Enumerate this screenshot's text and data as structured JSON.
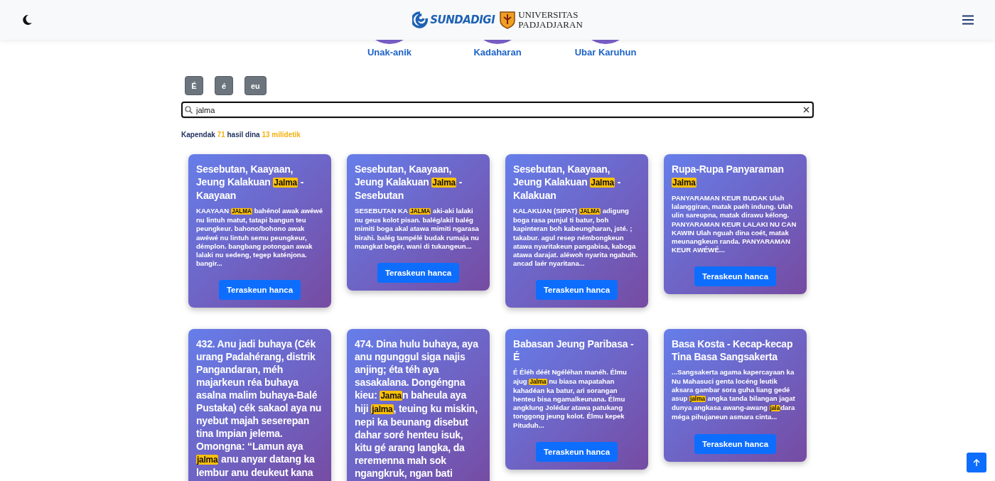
{
  "header": {
    "brand": "SUNDADIGI",
    "university_line_1": "UNIVERSITAS",
    "university_line_2": "PADJADJARAN"
  },
  "categories": [
    {
      "label": "Unak-anik"
    },
    {
      "label": "Kadaharan"
    },
    {
      "label": "Ubar Karuhun"
    }
  ],
  "letter_buttons": [
    "É",
    "é",
    "eu"
  ],
  "search": {
    "value": "jalma"
  },
  "summary": {
    "prefix": "Kapendak",
    "count": "71",
    "middle": "hasil dina",
    "time": "13 milidetik"
  },
  "cards": [
    {
      "title": [
        {
          "text": "Sesebutan, Kaayaan, Jeung Kalakuan ",
          "highlight": false
        },
        {
          "text": "Jalma",
          "highlight": true
        },
        {
          "text": " - Kaayaan",
          "highlight": false
        }
      ],
      "snippet": [
        {
          "text": "KAAYAAN ",
          "highlight": false
        },
        {
          "text": "JALMA",
          "highlight": true
        },
        {
          "text": " bahénol awak awéwé nu lintuh matut, tatapi bangun teu peungkeur. bahono/bohono awak awéwé nu lintuh semu peungkeur, démplon. bangbang potongan awak lalaki nu sedeng, tegep katénjona. bangir...",
          "highlight": false
        }
      ],
      "button": "Teraskeun hanca"
    },
    {
      "title": [
        {
          "text": "Sesebutan, Kaayaan, Jeung Kalakuan ",
          "highlight": false
        },
        {
          "text": "Jalma",
          "highlight": true
        },
        {
          "text": " - Sesebutan",
          "highlight": false
        }
      ],
      "snippet": [
        {
          "text": "SESEBUTAN KA ",
          "highlight": false
        },
        {
          "text": "JALMA",
          "highlight": true
        },
        {
          "text": " aki-aki lalaki nu geus kolot pisan. balég/akil balég mimiti boga akal atawa mimiti ngarasa birahi. balég tampélé budak rumaja nu mangkat begér, wani di tukangeun...",
          "highlight": false
        }
      ],
      "button": "Teraskeun hanca"
    },
    {
      "title": [
        {
          "text": "Sesebutan, Kaayaan, Jeung Kalakuan ",
          "highlight": false
        },
        {
          "text": "Jalma",
          "highlight": true
        },
        {
          "text": " - Kalakuan",
          "highlight": false
        }
      ],
      "snippet": [
        {
          "text": "KALAKUAN (SIPAT) ",
          "highlight": false
        },
        {
          "text": "JALMA",
          "highlight": true
        },
        {
          "text": " adigung boga rasa punjul ti batur, boh kapinteran boh kabeungharan, jsté. ; takabur. agul resep némbongkeun atawa nyaritakeun pangabisa, kaboga atawa darajat. aléwoh nyarita ngabuih. ancad laér nyaritana...",
          "highlight": false
        }
      ],
      "button": "Teraskeun hanca"
    },
    {
      "title": [
        {
          "text": "Rupa-Rupa Panyaraman ",
          "highlight": false
        },
        {
          "text": "Jalma",
          "highlight": true
        }
      ],
      "snippet": [
        {
          "text": "PANYARAMAN KEUR BUDAK Ulah lalanggiran, matak paéh indung. Ulah ulin sareupna, matak dirawu kélong. PANYARAMAN KEUR LALAKI NU CAN KAWIN Ulah nguah dina coét, matak meunangkeun randa. PANYARAMAN KEUR AWÉWÉ...",
          "highlight": false
        }
      ],
      "button": "Teraskeun hanca"
    },
    {
      "title": [
        {
          "text": "432. Anu jadi buhaya (Cék urang Padahérang, distrik Pangandaran, méh majarkeun réa buhaya asalna malim buhaya-Balé Pustaka) cék sakaol aya nu nyebut majah seserepan tina Impian jelema. Omongna: “Lamun aya ",
          "highlight": false
        },
        {
          "text": "jalma",
          "highlight": true
        },
        {
          "text": " anu anyar datang ka lembur anu deukeut kana",
          "highlight": false
        }
      ]
    },
    {
      "title": [
        {
          "text": "474. Dina hulu buhaya, aya anu ngunggul siga najis anjing; éta téh aya sasakalana. Dongéngna kieu: ",
          "highlight": false
        },
        {
          "text": "Jama",
          "highlight": true
        },
        {
          "text": "n baheula aya hiji ",
          "highlight": false
        },
        {
          "text": "jalma",
          "highlight": true
        },
        {
          "text": ", teuing ku miskin, nepi ka beunang disebut dahar soré henteu isuk, kitu gé arang langka, da reremenna mah sok ngangkruk, ngan bati",
          "highlight": false
        }
      ]
    },
    {
      "title": [
        {
          "text": "Babasan Jeung Paribasa - É",
          "highlight": false
        }
      ],
      "snippet": [
        {
          "text": "É Éléh déét Ngéléhan manéh. Élmu ajug ",
          "highlight": false
        },
        {
          "text": "Jalma",
          "highlight": true
        },
        {
          "text": " nu biasa mapatahan kahadéan ka batur, ari sorangan henteu bisa ngamalkeunana. Élmu angklung Jolédar atawa patukang tonggong jeung kolot. Élmu kepek Pituduh...",
          "highlight": false
        }
      ],
      "button": "Teraskeun hanca"
    },
    {
      "title": [
        {
          "text": "Basa Kosta - Kecap-kecap Tina Basa Sangsakerta",
          "highlight": false
        }
      ],
      "snippet": [
        {
          "text": "...Sangsakerta agama kapercayaan ka Nu Mahasuci genta locéng leutik aksara gambar sora guha liang gedé asup ",
          "highlight": false
        },
        {
          "text": "jalma",
          "highlight": true
        },
        {
          "text": " angka tanda bilangan jagat dunya angkasa awang-awang ",
          "highlight": false
        },
        {
          "text": "jala",
          "highlight": true
        },
        {
          "text": "dara méga pihujaneun asmara cinta...",
          "highlight": false
        }
      ],
      "button": "Teraskeun hanca"
    }
  ]
}
